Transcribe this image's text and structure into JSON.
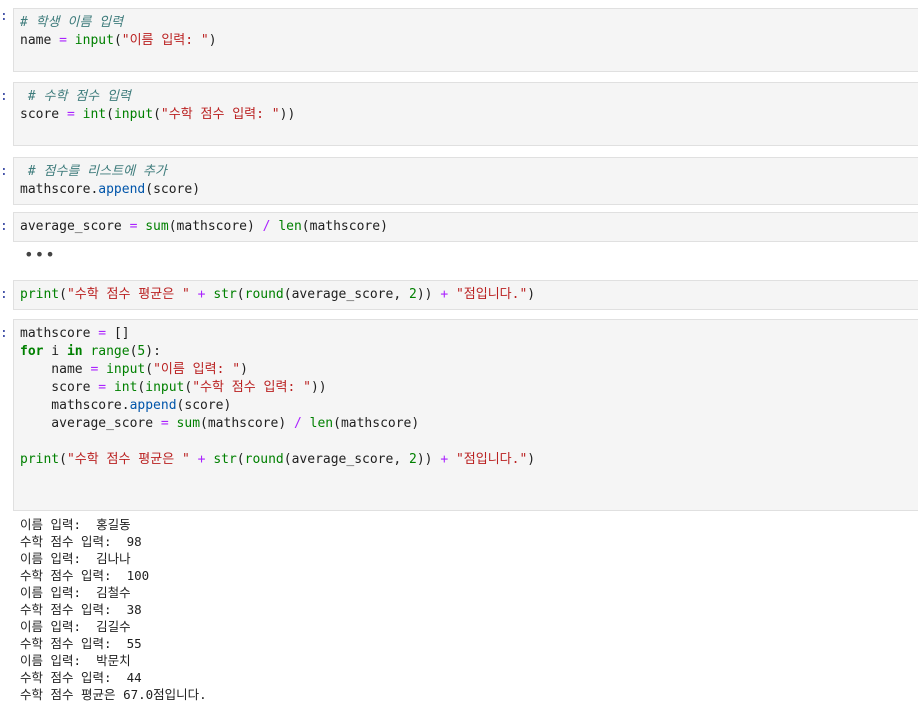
{
  "notebook": {
    "prompt_marker": ":",
    "cells": [
      {
        "lines": [
          [
            {
              "t": "cm",
              "v": "# 학생 이름 입력"
            }
          ],
          [
            {
              "t": "",
              "v": "name "
            },
            {
              "t": "op",
              "v": "="
            },
            {
              "t": "",
              "v": " "
            },
            {
              "t": "bi",
              "v": "input"
            },
            {
              "t": "br",
              "v": "("
            },
            {
              "t": "str",
              "v": "\"이름 입력: \""
            },
            {
              "t": "br",
              "v": ")"
            }
          ]
        ]
      },
      {
        "lines": [
          [
            {
              "t": "cm",
              "v": " # 수학 점수 입력"
            }
          ],
          [
            {
              "t": "",
              "v": "score "
            },
            {
              "t": "op",
              "v": "="
            },
            {
              "t": "",
              "v": " "
            },
            {
              "t": "bi",
              "v": "int"
            },
            {
              "t": "br",
              "v": "("
            },
            {
              "t": "bi",
              "v": "input"
            },
            {
              "t": "br",
              "v": "("
            },
            {
              "t": "str",
              "v": "\"수학 점수 입력: \""
            },
            {
              "t": "br",
              "v": "))"
            }
          ]
        ]
      },
      {
        "lines": [
          [
            {
              "t": "cm",
              "v": " # 점수를 리스트에 추가"
            }
          ],
          [
            {
              "t": "",
              "v": "mathscore."
            },
            {
              "t": "attr",
              "v": "append"
            },
            {
              "t": "br",
              "v": "("
            },
            {
              "t": "",
              "v": "score"
            },
            {
              "t": "br",
              "v": ")"
            }
          ]
        ]
      },
      {
        "lines": [
          [
            {
              "t": "",
              "v": "average_score "
            },
            {
              "t": "op",
              "v": "="
            },
            {
              "t": "",
              "v": " "
            },
            {
              "t": "bi",
              "v": "sum"
            },
            {
              "t": "br",
              "v": "("
            },
            {
              "t": "",
              "v": "mathscore"
            },
            {
              "t": "br",
              "v": ")"
            },
            {
              "t": "",
              "v": " "
            },
            {
              "t": "op",
              "v": "/"
            },
            {
              "t": "",
              "v": " "
            },
            {
              "t": "bi",
              "v": "len"
            },
            {
              "t": "br",
              "v": "("
            },
            {
              "t": "",
              "v": "mathscore"
            },
            {
              "t": "br",
              "v": ")"
            }
          ]
        ]
      },
      {
        "lines": [
          [
            {
              "t": "bi",
              "v": "print"
            },
            {
              "t": "br",
              "v": "("
            },
            {
              "t": "str",
              "v": "\"수학 점수 평균은 \""
            },
            {
              "t": "",
              "v": " "
            },
            {
              "t": "op",
              "v": "+"
            },
            {
              "t": "",
              "v": " "
            },
            {
              "t": "bi",
              "v": "str"
            },
            {
              "t": "br",
              "v": "("
            },
            {
              "t": "bi",
              "v": "round"
            },
            {
              "t": "br",
              "v": "("
            },
            {
              "t": "",
              "v": "average_score, "
            },
            {
              "t": "num",
              "v": "2"
            },
            {
              "t": "br",
              "v": "))"
            },
            {
              "t": "",
              "v": " "
            },
            {
              "t": "op",
              "v": "+"
            },
            {
              "t": "",
              "v": " "
            },
            {
              "t": "str",
              "v": "\"점입니다.\""
            },
            {
              "t": "br",
              "v": ")"
            }
          ]
        ]
      },
      {
        "lines": [
          [
            {
              "t": "",
              "v": "mathscore "
            },
            {
              "t": "op",
              "v": "="
            },
            {
              "t": "",
              "v": " "
            },
            {
              "t": "br",
              "v": "[]"
            }
          ],
          [
            {
              "t": "kw",
              "v": "for"
            },
            {
              "t": "",
              "v": " i "
            },
            {
              "t": "kw",
              "v": "in"
            },
            {
              "t": "",
              "v": " "
            },
            {
              "t": "bi",
              "v": "range"
            },
            {
              "t": "br",
              "v": "("
            },
            {
              "t": "num",
              "v": "5"
            },
            {
              "t": "br",
              "v": ")"
            },
            {
              "t": "",
              "v": ":"
            }
          ],
          [
            {
              "t": "",
              "v": "    name "
            },
            {
              "t": "op",
              "v": "="
            },
            {
              "t": "",
              "v": " "
            },
            {
              "t": "bi",
              "v": "input"
            },
            {
              "t": "br",
              "v": "("
            },
            {
              "t": "str",
              "v": "\"이름 입력: \""
            },
            {
              "t": "br",
              "v": ")"
            }
          ],
          [
            {
              "t": "",
              "v": "    score "
            },
            {
              "t": "op",
              "v": "="
            },
            {
              "t": "",
              "v": " "
            },
            {
              "t": "bi",
              "v": "int"
            },
            {
              "t": "br",
              "v": "("
            },
            {
              "t": "bi",
              "v": "input"
            },
            {
              "t": "br",
              "v": "("
            },
            {
              "t": "str",
              "v": "\"수학 점수 입력: \""
            },
            {
              "t": "br",
              "v": "))"
            }
          ],
          [
            {
              "t": "",
              "v": "    mathscore."
            },
            {
              "t": "attr",
              "v": "append"
            },
            {
              "t": "br",
              "v": "("
            },
            {
              "t": "",
              "v": "score"
            },
            {
              "t": "br",
              "v": ")"
            }
          ],
          [
            {
              "t": "",
              "v": "    average_score "
            },
            {
              "t": "op",
              "v": "="
            },
            {
              "t": "",
              "v": " "
            },
            {
              "t": "bi",
              "v": "sum"
            },
            {
              "t": "br",
              "v": "("
            },
            {
              "t": "",
              "v": "mathscore"
            },
            {
              "t": "br",
              "v": ")"
            },
            {
              "t": "",
              "v": " "
            },
            {
              "t": "op",
              "v": "/"
            },
            {
              "t": "",
              "v": " "
            },
            {
              "t": "bi",
              "v": "len"
            },
            {
              "t": "br",
              "v": "("
            },
            {
              "t": "",
              "v": "mathscore"
            },
            {
              "t": "br",
              "v": ")"
            }
          ],
          [],
          [
            {
              "t": "bi",
              "v": "print"
            },
            {
              "t": "br",
              "v": "("
            },
            {
              "t": "str",
              "v": "\"수학 점수 평균은 \""
            },
            {
              "t": "",
              "v": " "
            },
            {
              "t": "op",
              "v": "+"
            },
            {
              "t": "",
              "v": " "
            },
            {
              "t": "bi",
              "v": "str"
            },
            {
              "t": "br",
              "v": "("
            },
            {
              "t": "bi",
              "v": "round"
            },
            {
              "t": "br",
              "v": "("
            },
            {
              "t": "",
              "v": "average_score, "
            },
            {
              "t": "num",
              "v": "2"
            },
            {
              "t": "br",
              "v": "))"
            },
            {
              "t": "",
              "v": " "
            },
            {
              "t": "op",
              "v": "+"
            },
            {
              "t": "",
              "v": " "
            },
            {
              "t": "str",
              "v": "\"점입니다.\""
            },
            {
              "t": "br",
              "v": ")"
            }
          ]
        ]
      }
    ],
    "collapsed_output": "•••",
    "output_lines": [
      "이름 입력:  홍길동",
      "수학 점수 입력:  98",
      "이름 입력:  김나나",
      "수학 점수 입력:  100",
      "이름 입력:  김철수",
      "수학 점수 입력:  38",
      "이름 입력:  김길수",
      "수학 점수 입력:  55",
      "이름 입력:  박문치",
      "수학 점수 입력:  44",
      "수학 점수 평균은 67.0점입니다."
    ]
  }
}
